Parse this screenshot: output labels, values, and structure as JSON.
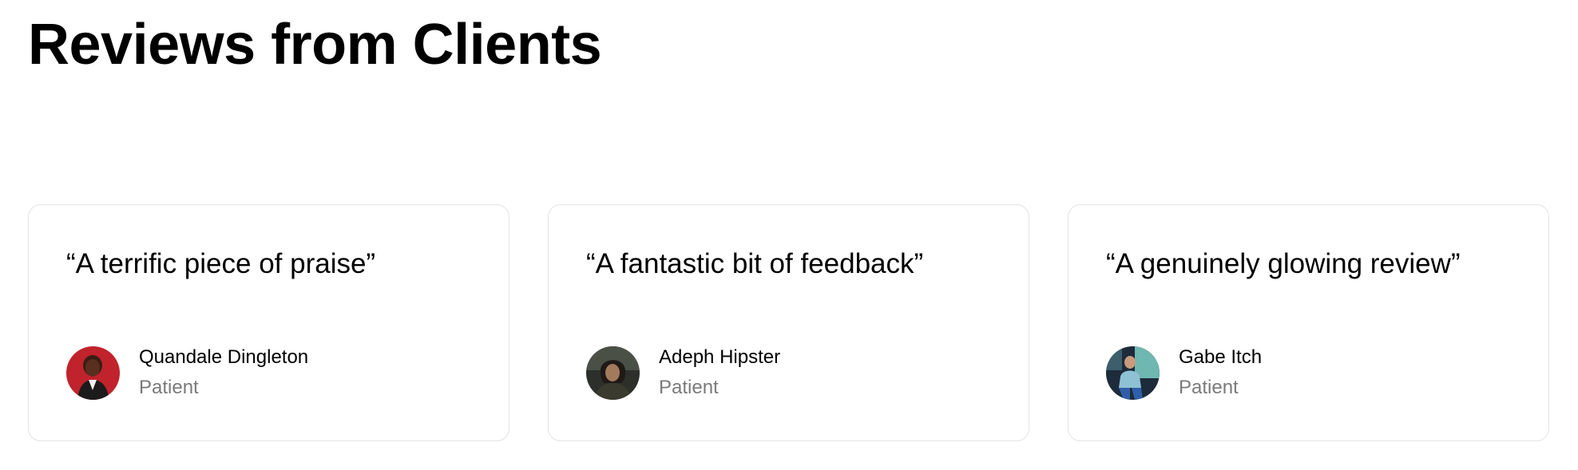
{
  "page": {
    "title": "Reviews from Clients"
  },
  "reviews": [
    {
      "quote": "“A terrific piece of praise”",
      "name": "Quandale Dingleton",
      "role": "Patient",
      "avatar_icon": "person-photo-red-background"
    },
    {
      "quote": "“A fantastic bit of feedback”",
      "name": "Adeph Hipster",
      "role": "Patient",
      "avatar_icon": "person-photo-dark-background"
    },
    {
      "quote": "“A genuinely glowing review”",
      "name": "Gabe Itch",
      "role": "Patient",
      "avatar_icon": "person-photo-teal-background"
    }
  ],
  "colors": {
    "text": "#000000",
    "muted_text": "#7a7a7a",
    "card_border": "#e3e3e3",
    "background": "#ffffff"
  }
}
